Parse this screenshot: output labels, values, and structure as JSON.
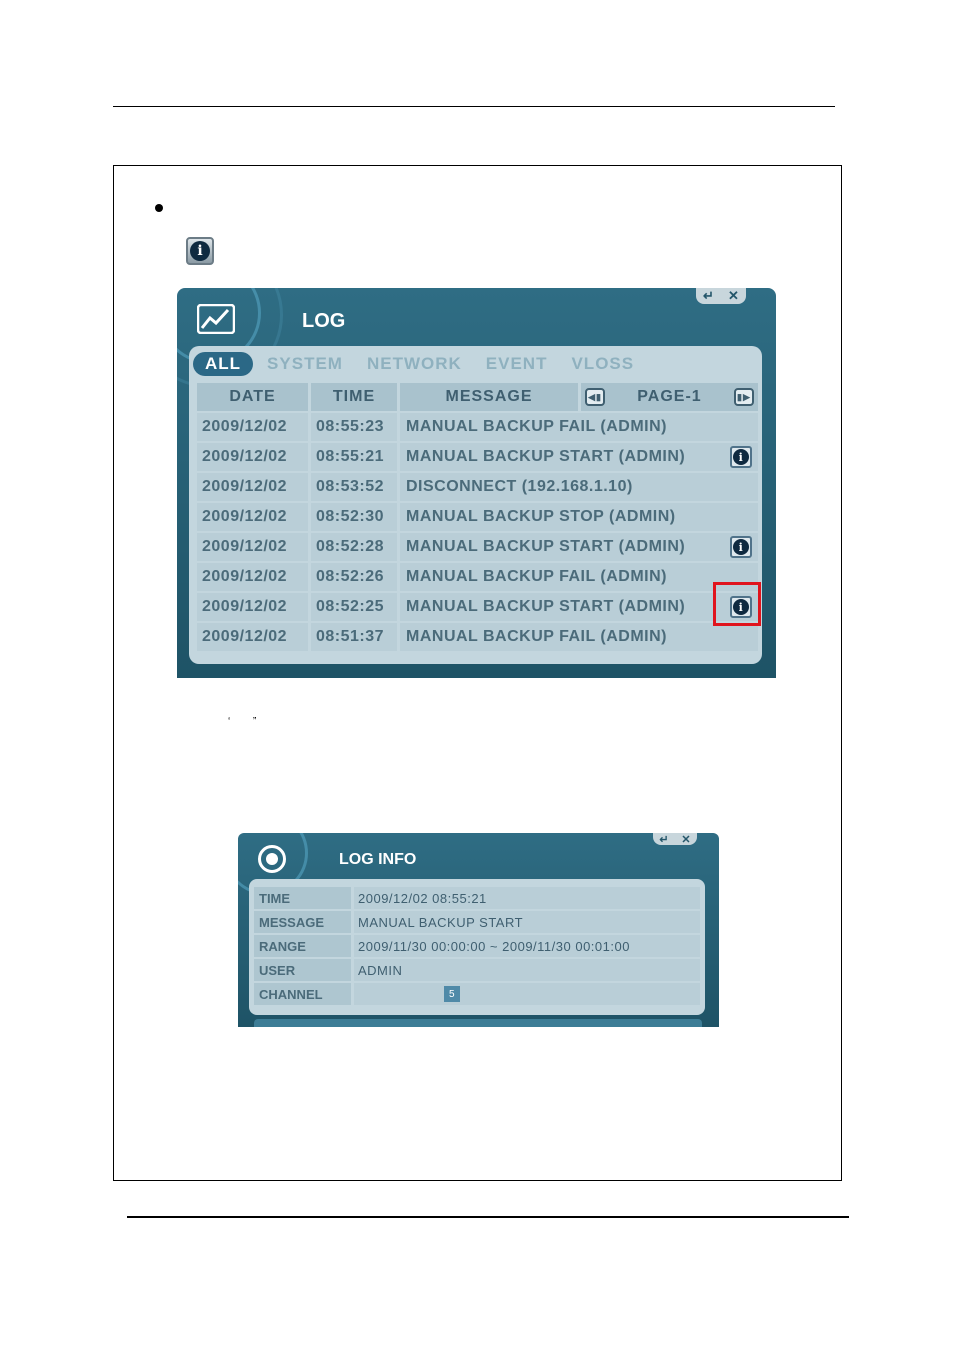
{
  "doc": {
    "quote_marks": "‘ ”"
  },
  "log_window": {
    "title": "LOG",
    "controls": [
      "↵",
      "✕"
    ],
    "tabs": [
      {
        "label": "ALL",
        "active": true
      },
      {
        "label": "SYSTEM",
        "active": false
      },
      {
        "label": "NETWORK",
        "active": false
      },
      {
        "label": "EVENT",
        "active": false
      },
      {
        "label": "VLOSS",
        "active": false
      }
    ],
    "columns": {
      "date": "DATE",
      "time": "TIME",
      "message": "MESSAGE"
    },
    "pager": {
      "label": "PAGE-1",
      "prev_glyph": "◀▮",
      "next_glyph": "▮▶"
    },
    "rows": [
      {
        "date": "2009/12/02",
        "time": "08:55:23",
        "message": "MANUAL BACKUP FAIL (ADMIN)",
        "info": false
      },
      {
        "date": "2009/12/02",
        "time": "08:55:21",
        "message": "MANUAL BACKUP START (ADMIN)",
        "info": true
      },
      {
        "date": "2009/12/02",
        "time": "08:53:52",
        "message": "DISCONNECT (192.168.1.10)",
        "info": false
      },
      {
        "date": "2009/12/02",
        "time": "08:52:30",
        "message": "MANUAL BACKUP STOP (ADMIN)",
        "info": false
      },
      {
        "date": "2009/12/02",
        "time": "08:52:28",
        "message": "MANUAL BACKUP START (ADMIN)",
        "info": true
      },
      {
        "date": "2009/12/02",
        "time": "08:52:26",
        "message": "MANUAL BACKUP FAIL (ADMIN)",
        "info": false
      },
      {
        "date": "2009/12/02",
        "time": "08:52:25",
        "message": "MANUAL BACKUP START (ADMIN)",
        "info": true
      },
      {
        "date": "2009/12/02",
        "time": "08:51:37",
        "message": "MANUAL BACKUP FAIL (ADMIN)",
        "info": false
      }
    ]
  },
  "info_glyph": "i",
  "log_info_window": {
    "title": "LOG INFO",
    "controls": [
      "↵",
      "✕"
    ],
    "fields": [
      {
        "key": "TIME",
        "value": "2009/12/02 08:55:21"
      },
      {
        "key": "MESSAGE",
        "value": "MANUAL BACKUP START"
      },
      {
        "key": "RANGE",
        "value": "2009/11/30 00:00:00 ~ 2009/11/30 00:01:00"
      },
      {
        "key": "USER",
        "value": "ADMIN"
      },
      {
        "key": "CHANNEL",
        "value": "",
        "badge": "5"
      }
    ]
  },
  "colors": {
    "window": "#2f6d84",
    "panel": "#c3d6de",
    "active_tab": "#2b6886",
    "highlight": "#e0141d"
  }
}
